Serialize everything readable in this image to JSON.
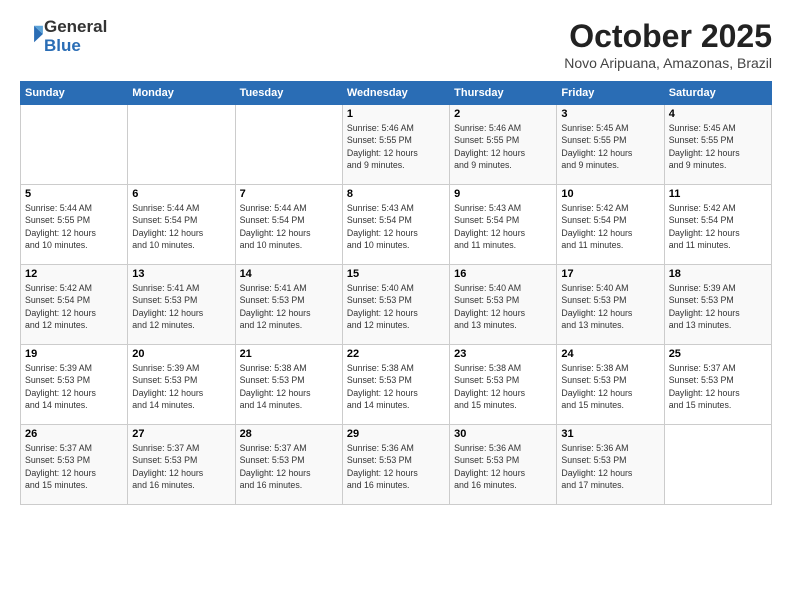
{
  "logo": {
    "line1": "General",
    "line2": "Blue"
  },
  "title": "October 2025",
  "subtitle": "Novo Aripuana, Amazonas, Brazil",
  "days_of_week": [
    "Sunday",
    "Monday",
    "Tuesday",
    "Wednesday",
    "Thursday",
    "Friday",
    "Saturday"
  ],
  "weeks": [
    [
      {
        "num": "",
        "info": ""
      },
      {
        "num": "",
        "info": ""
      },
      {
        "num": "",
        "info": ""
      },
      {
        "num": "1",
        "info": "Sunrise: 5:46 AM\nSunset: 5:55 PM\nDaylight: 12 hours\nand 9 minutes."
      },
      {
        "num": "2",
        "info": "Sunrise: 5:46 AM\nSunset: 5:55 PM\nDaylight: 12 hours\nand 9 minutes."
      },
      {
        "num": "3",
        "info": "Sunrise: 5:45 AM\nSunset: 5:55 PM\nDaylight: 12 hours\nand 9 minutes."
      },
      {
        "num": "4",
        "info": "Sunrise: 5:45 AM\nSunset: 5:55 PM\nDaylight: 12 hours\nand 9 minutes."
      }
    ],
    [
      {
        "num": "5",
        "info": "Sunrise: 5:44 AM\nSunset: 5:55 PM\nDaylight: 12 hours\nand 10 minutes."
      },
      {
        "num": "6",
        "info": "Sunrise: 5:44 AM\nSunset: 5:54 PM\nDaylight: 12 hours\nand 10 minutes."
      },
      {
        "num": "7",
        "info": "Sunrise: 5:44 AM\nSunset: 5:54 PM\nDaylight: 12 hours\nand 10 minutes."
      },
      {
        "num": "8",
        "info": "Sunrise: 5:43 AM\nSunset: 5:54 PM\nDaylight: 12 hours\nand 10 minutes."
      },
      {
        "num": "9",
        "info": "Sunrise: 5:43 AM\nSunset: 5:54 PM\nDaylight: 12 hours\nand 11 minutes."
      },
      {
        "num": "10",
        "info": "Sunrise: 5:42 AM\nSunset: 5:54 PM\nDaylight: 12 hours\nand 11 minutes."
      },
      {
        "num": "11",
        "info": "Sunrise: 5:42 AM\nSunset: 5:54 PM\nDaylight: 12 hours\nand 11 minutes."
      }
    ],
    [
      {
        "num": "12",
        "info": "Sunrise: 5:42 AM\nSunset: 5:54 PM\nDaylight: 12 hours\nand 12 minutes."
      },
      {
        "num": "13",
        "info": "Sunrise: 5:41 AM\nSunset: 5:53 PM\nDaylight: 12 hours\nand 12 minutes."
      },
      {
        "num": "14",
        "info": "Sunrise: 5:41 AM\nSunset: 5:53 PM\nDaylight: 12 hours\nand 12 minutes."
      },
      {
        "num": "15",
        "info": "Sunrise: 5:40 AM\nSunset: 5:53 PM\nDaylight: 12 hours\nand 12 minutes."
      },
      {
        "num": "16",
        "info": "Sunrise: 5:40 AM\nSunset: 5:53 PM\nDaylight: 12 hours\nand 13 minutes."
      },
      {
        "num": "17",
        "info": "Sunrise: 5:40 AM\nSunset: 5:53 PM\nDaylight: 12 hours\nand 13 minutes."
      },
      {
        "num": "18",
        "info": "Sunrise: 5:39 AM\nSunset: 5:53 PM\nDaylight: 12 hours\nand 13 minutes."
      }
    ],
    [
      {
        "num": "19",
        "info": "Sunrise: 5:39 AM\nSunset: 5:53 PM\nDaylight: 12 hours\nand 14 minutes."
      },
      {
        "num": "20",
        "info": "Sunrise: 5:39 AM\nSunset: 5:53 PM\nDaylight: 12 hours\nand 14 minutes."
      },
      {
        "num": "21",
        "info": "Sunrise: 5:38 AM\nSunset: 5:53 PM\nDaylight: 12 hours\nand 14 minutes."
      },
      {
        "num": "22",
        "info": "Sunrise: 5:38 AM\nSunset: 5:53 PM\nDaylight: 12 hours\nand 14 minutes."
      },
      {
        "num": "23",
        "info": "Sunrise: 5:38 AM\nSunset: 5:53 PM\nDaylight: 12 hours\nand 15 minutes."
      },
      {
        "num": "24",
        "info": "Sunrise: 5:38 AM\nSunset: 5:53 PM\nDaylight: 12 hours\nand 15 minutes."
      },
      {
        "num": "25",
        "info": "Sunrise: 5:37 AM\nSunset: 5:53 PM\nDaylight: 12 hours\nand 15 minutes."
      }
    ],
    [
      {
        "num": "26",
        "info": "Sunrise: 5:37 AM\nSunset: 5:53 PM\nDaylight: 12 hours\nand 15 minutes."
      },
      {
        "num": "27",
        "info": "Sunrise: 5:37 AM\nSunset: 5:53 PM\nDaylight: 12 hours\nand 16 minutes."
      },
      {
        "num": "28",
        "info": "Sunrise: 5:37 AM\nSunset: 5:53 PM\nDaylight: 12 hours\nand 16 minutes."
      },
      {
        "num": "29",
        "info": "Sunrise: 5:36 AM\nSunset: 5:53 PM\nDaylight: 12 hours\nand 16 minutes."
      },
      {
        "num": "30",
        "info": "Sunrise: 5:36 AM\nSunset: 5:53 PM\nDaylight: 12 hours\nand 16 minutes."
      },
      {
        "num": "31",
        "info": "Sunrise: 5:36 AM\nSunset: 5:53 PM\nDaylight: 12 hours\nand 17 minutes."
      },
      {
        "num": "",
        "info": ""
      }
    ]
  ]
}
